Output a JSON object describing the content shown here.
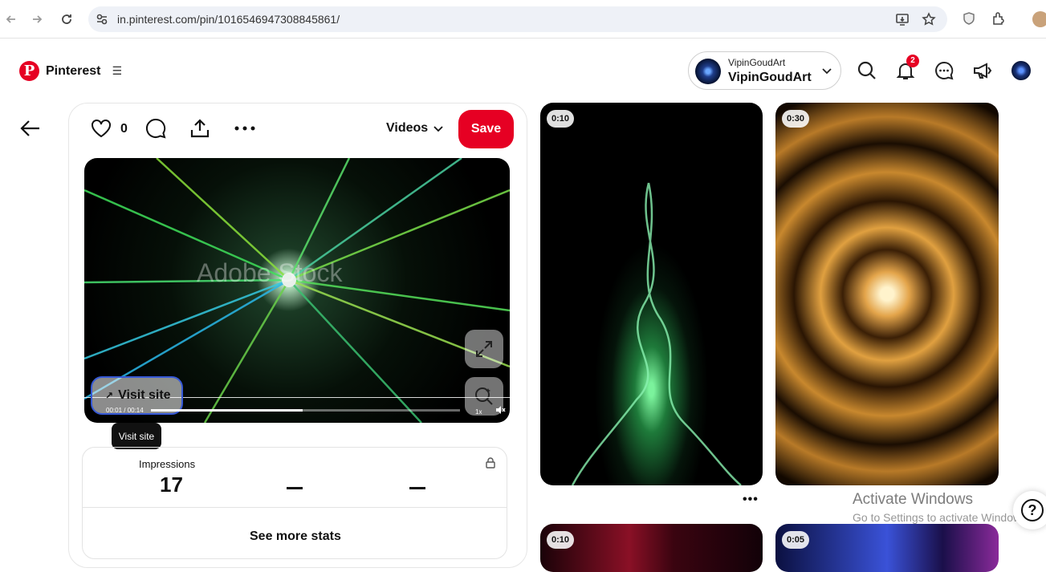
{
  "browser": {
    "url": "in.pinterest.com/pin/1016546947308845861/"
  },
  "header": {
    "logo_text": "Pinterest",
    "account_small": "VipinGoudArt",
    "account_big": "VipinGoudArt",
    "notifications_badge": "2"
  },
  "pin": {
    "like_count": "0",
    "dropdown_label": "Videos",
    "save_label": "Save",
    "video": {
      "watermark": "Adobe Stock",
      "visit_site_label": "Visit site",
      "tooltip": "Visit site",
      "time": "00:01 / 00:14",
      "speed": "1x",
      "progress_fraction": 0.49
    },
    "stats": {
      "impressions_label": "Impressions",
      "impressions_value": "17",
      "dash1": "—",
      "dash2": "—",
      "see_more_label": "See more stats"
    }
  },
  "grid": {
    "tiles": [
      {
        "duration": "0:10"
      },
      {
        "duration": "0:30"
      },
      {
        "duration": "0:10"
      },
      {
        "duration": "0:05"
      }
    ],
    "more_dots": "•••"
  },
  "windows_activation": {
    "title": "Activate Windows",
    "subtitle": "Go to Settings to activate Windows."
  },
  "help_label": "?"
}
